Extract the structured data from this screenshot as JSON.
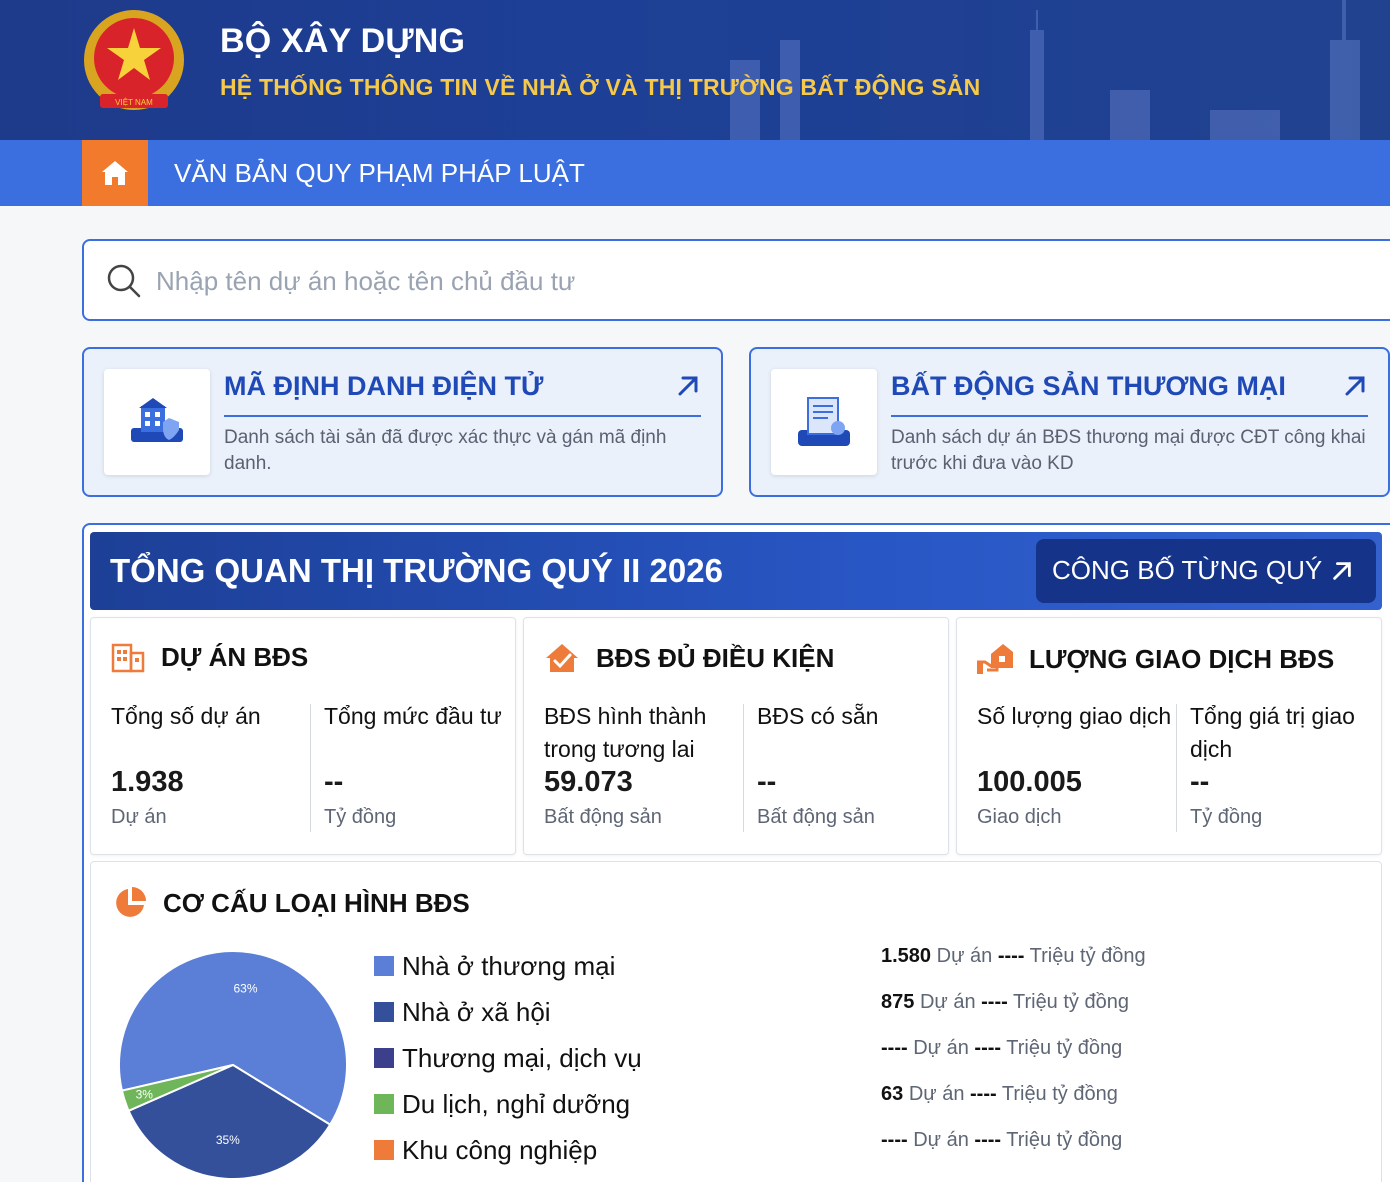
{
  "header": {
    "title": "BỘ XÂY DỰNG",
    "subtitle": "HỆ THỐNG THÔNG TIN VỀ NHÀ Ở VÀ THỊ TRƯỜNG BẤT ĐỘNG SẢN",
    "emblem_text": "VIỆT NAM"
  },
  "nav": {
    "home_icon": "home-icon",
    "item": "VĂN BẢN QUY PHẠM PHÁP LUẬT"
  },
  "search": {
    "placeholder": "Nhập tên dự án hoặc tên chủ đầu tư",
    "value": ""
  },
  "cards": [
    {
      "title": "MÃ ĐỊNH DANH ĐIỆN TỬ",
      "desc": "Danh sách tài sản đã được xác thực và gán mã định danh."
    },
    {
      "title": "BẤT ĐỘNG SẢN THƯƠNG MẠI",
      "desc": "Danh sách dự án BĐS thương mại được CĐT công khai trước khi đưa vào KD"
    }
  ],
  "overview": {
    "title": "TỔNG QUAN THỊ TRƯỜNG QUÝ II 2026",
    "publish_button": "CÔNG BỐ TỪNG QUÝ"
  },
  "stats": [
    {
      "title": "DỰ ÁN BĐS",
      "cols": [
        {
          "label": "Tổng số dự án",
          "value": "1.938",
          "unit": "Dự án"
        },
        {
          "label": "Tổng mức đầu tư",
          "value": "--",
          "unit": "Tỷ đồng"
        }
      ]
    },
    {
      "title": "BĐS ĐỦ ĐIỀU KIỆN",
      "cols": [
        {
          "label": "BĐS hình thành trong tương lai",
          "value": "59.073",
          "unit": "Bất động sản"
        },
        {
          "label": "BĐS có sẵn",
          "value": "--",
          "unit": "Bất động sản"
        }
      ]
    },
    {
      "title": "LƯỢNG GIAO DỊCH BĐS",
      "cols": [
        {
          "label": "Số lượng giao dịch",
          "value": "100.005",
          "unit": "Giao dịch"
        },
        {
          "label": "Tổng giá trị giao dịch",
          "value": "--",
          "unit": "Tỷ đồng"
        }
      ]
    }
  ],
  "structure": {
    "title": "CƠ CẤU LOẠI HÌNH BĐS",
    "legend": [
      {
        "label": "Nhà ở thương mại",
        "color": "#5b7fd6"
      },
      {
        "label": "Nhà ở xã hội",
        "color": "#34509b"
      },
      {
        "label": "Thương mại, dịch vụ",
        "color": "#3c3f8c"
      },
      {
        "label": "Du lịch, nghỉ dưỡng",
        "color": "#6fb55a"
      },
      {
        "label": "Khu công nghiệp",
        "color": "#ee7b3a"
      }
    ],
    "rows": [
      {
        "count": "1.580",
        "unit1": "Dự án",
        "value": "----",
        "unit2": "Triệu tỷ đồng"
      },
      {
        "count": "875",
        "unit1": "Dự án",
        "value": "----",
        "unit2": "Triệu tỷ đồng"
      },
      {
        "count": "----",
        "unit1": "Dự án",
        "value": "----",
        "unit2": "Triệu tỷ đồng"
      },
      {
        "count": "63",
        "unit1": "Dự án",
        "value": "----",
        "unit2": "Triệu tỷ đồng"
      },
      {
        "count": "----",
        "unit1": "Dự án",
        "value": "----",
        "unit2": "Triệu tỷ đồng"
      }
    ]
  },
  "chart_data": {
    "type": "pie",
    "categories": [
      "Nhà ở thương mại",
      "Nhà ở xã hội",
      "Du lịch, nghỉ dưỡng"
    ],
    "values": [
      63,
      35,
      3
    ],
    "labels": [
      "63%",
      "35%",
      "3%"
    ],
    "colors": [
      "#5b7fd6",
      "#34509b",
      "#6fb55a"
    ]
  }
}
